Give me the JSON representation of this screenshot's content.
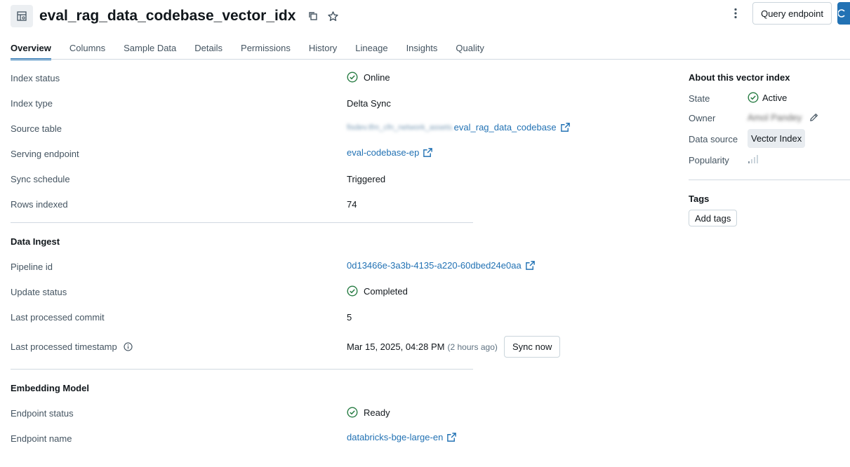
{
  "header": {
    "title": "eval_rag_data_codebase_vector_idx",
    "title_icon": "vector-index-icon",
    "query_endpoint_label": "Query endpoint"
  },
  "tabs": [
    {
      "label": "Overview",
      "active": true
    },
    {
      "label": "Columns"
    },
    {
      "label": "Sample Data"
    },
    {
      "label": "Details"
    },
    {
      "label": "Permissions"
    },
    {
      "label": "History"
    },
    {
      "label": "Lineage"
    },
    {
      "label": "Insights"
    },
    {
      "label": "Quality"
    }
  ],
  "overview": {
    "index_status": {
      "label": "Index status",
      "value": "Online"
    },
    "index_type": {
      "label": "Index type",
      "value": "Delta Sync"
    },
    "source_table": {
      "label": "Source table",
      "prefix_blurred": "fisdev.tfm_cfn_network_assets.",
      "value": "eval_rag_data_codebase"
    },
    "serving_endpoint": {
      "label": "Serving endpoint",
      "value": "eval-codebase-ep"
    },
    "sync_schedule": {
      "label": "Sync schedule",
      "value": "Triggered"
    },
    "rows_indexed": {
      "label": "Rows indexed",
      "value": "74"
    }
  },
  "data_ingest": {
    "title": "Data Ingest",
    "pipeline_id": {
      "label": "Pipeline id",
      "value": "0d13466e-3a3b-4135-a220-60dbed24e0aa"
    },
    "update_status": {
      "label": "Update status",
      "value": "Completed"
    },
    "last_commit": {
      "label": "Last processed commit",
      "value": "5"
    },
    "last_timestamp": {
      "label": "Last processed timestamp",
      "value": "Mar 15, 2025, 04:28 PM",
      "relative": "(2 hours ago)"
    },
    "sync_now_label": "Sync now"
  },
  "embedding_model": {
    "title": "Embedding Model",
    "endpoint_status": {
      "label": "Endpoint status",
      "value": "Ready"
    },
    "endpoint_name": {
      "label": "Endpoint name",
      "value": "databricks-bge-large-en"
    }
  },
  "about": {
    "title": "About this vector index",
    "state": {
      "label": "State",
      "value": "Active"
    },
    "owner": {
      "label": "Owner",
      "value_blurred": "Amol Pandey"
    },
    "data_source": {
      "label": "Data source",
      "value": "Vector Index"
    },
    "popularity": {
      "label": "Popularity"
    },
    "tags_title": "Tags",
    "add_tags_label": "Add tags"
  },
  "colors": {
    "link": "#2272b4",
    "success": "#277c43",
    "text": "#11171c",
    "muted": "#445461"
  }
}
